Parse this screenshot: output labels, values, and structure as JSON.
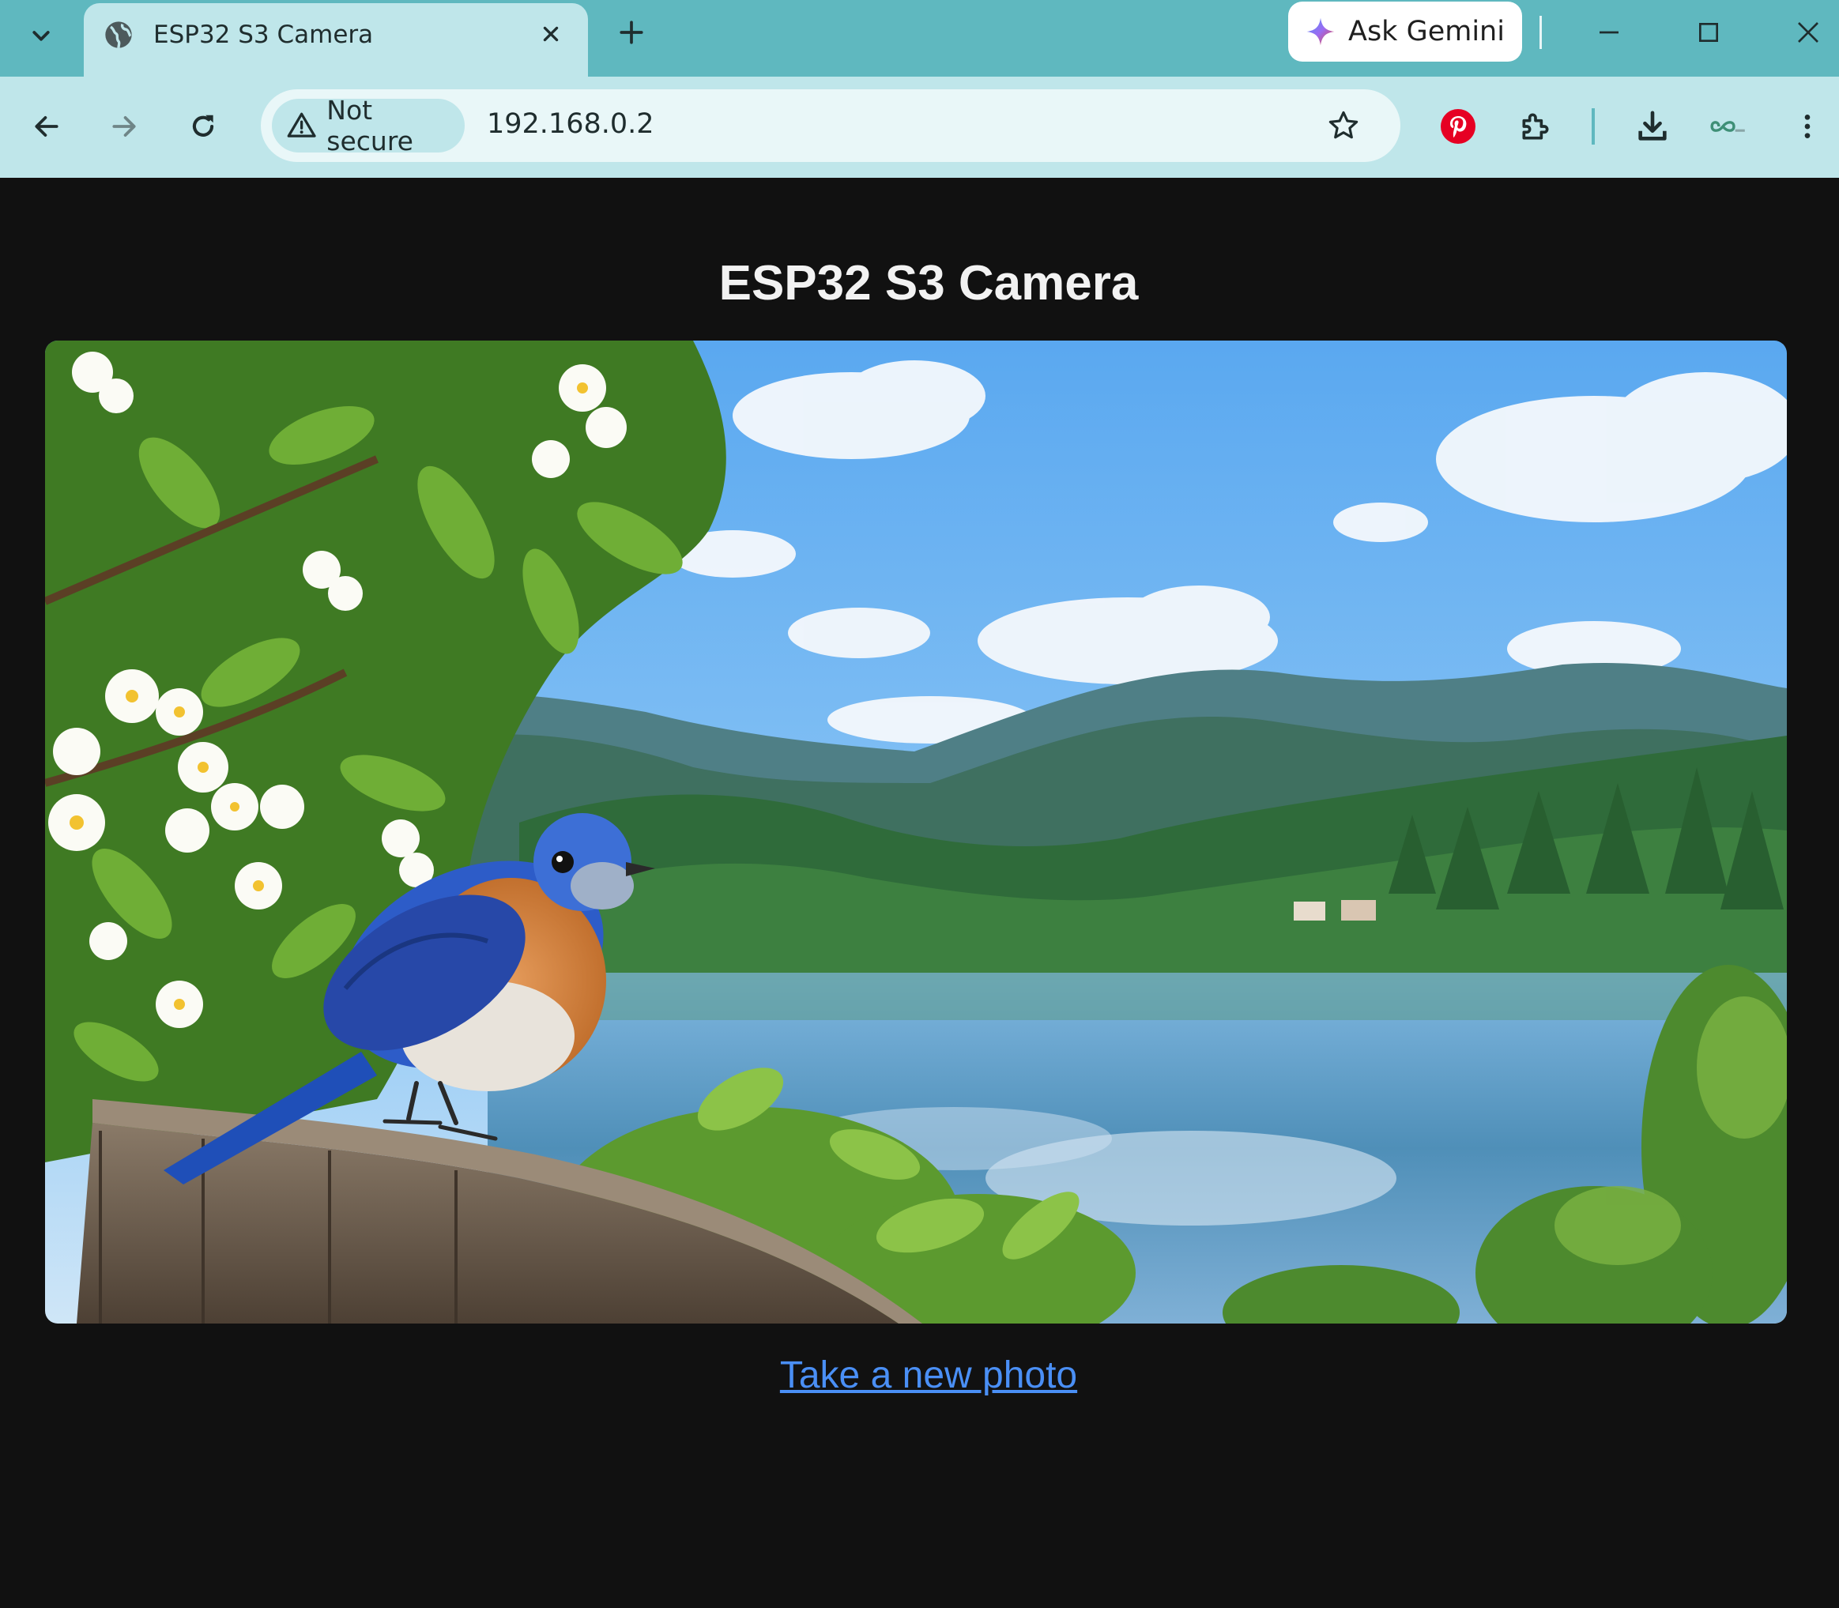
{
  "browser": {
    "tab": {
      "title": "ESP32 S3 Camera",
      "favicon": "globe-icon"
    },
    "gemini_label": "Ask Gemini",
    "address_bar": {
      "security_label": "Not secure",
      "url": "192.168.0.2"
    },
    "icons": {
      "tab_search": "chevron-down-icon",
      "tab_close": "close-icon",
      "new_tab": "plus-icon",
      "minimize": "minimize-icon",
      "maximize": "maximize-icon",
      "close_window": "close-icon",
      "back": "arrow-left-icon",
      "forward": "arrow-right-icon",
      "reload": "reload-icon",
      "warning": "warning-triangle-icon",
      "bookmark": "star-icon",
      "pinterest": "pinterest-icon",
      "extensions": "puzzle-icon",
      "downloads": "download-icon",
      "profile": "infinity-icon",
      "menu": "more-vertical-icon"
    },
    "colors": {
      "tabstrip": "#5fb8bf",
      "toolbar": "#bfe6ea",
      "pinterest": "#e60023"
    }
  },
  "page": {
    "title": "ESP32 S3 Camera",
    "photo": {
      "subject": "camera-photo"
    },
    "new_photo_link": "Take a new photo",
    "colors": {
      "background": "#111111",
      "link": "#4a8ff5"
    }
  }
}
